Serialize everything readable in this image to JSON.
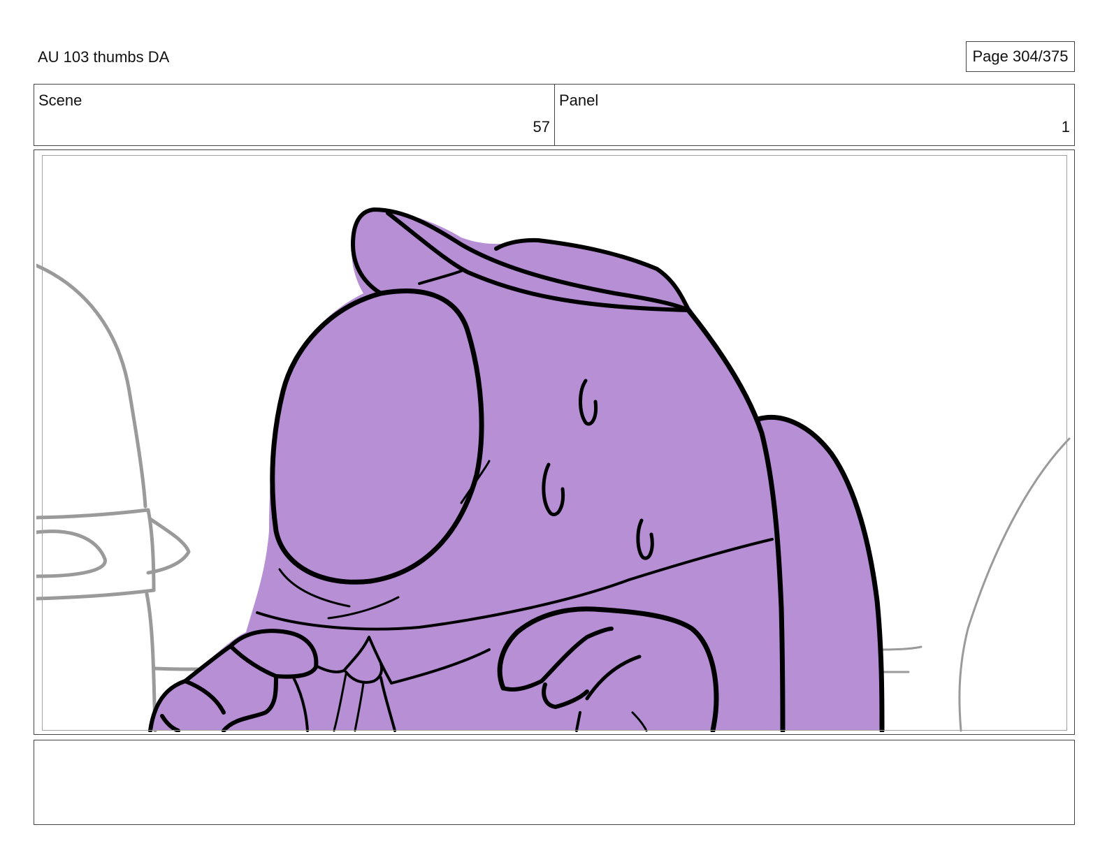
{
  "document": {
    "title": "AU 103 thumbs DA",
    "page_label": "Page 304/375"
  },
  "info": {
    "scene_label": "Scene",
    "scene_number": "57",
    "panel_label": "Panel",
    "panel_number": "1"
  },
  "notes": {
    "text": ""
  },
  "colors": {
    "character_fill": "#b68fd5",
    "ink": "#000000",
    "background_sketch": "#9a9a9a"
  }
}
